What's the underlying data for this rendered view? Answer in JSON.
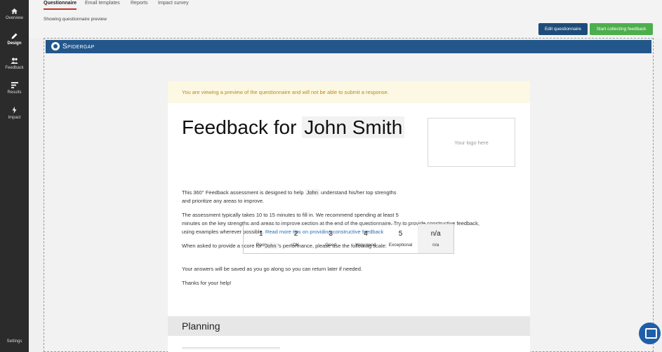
{
  "sidebar": {
    "items": [
      {
        "label": "Overview",
        "icon": "home-icon"
      },
      {
        "label": "Design",
        "icon": "pencil-icon"
      },
      {
        "label": "Feedback",
        "icon": "users-icon"
      },
      {
        "label": "Results",
        "icon": "bars-icon"
      },
      {
        "label": "Impact",
        "icon": "bolt-icon"
      }
    ],
    "settings_label": "Settings"
  },
  "tabs": [
    "Questionnaire",
    "Email templates",
    "Reports",
    "Impact survey"
  ],
  "subheader": {
    "showing": "Showing questionnaire preview",
    "edit_label": "Edit questionnaire",
    "start_label": "Start collecting feedback"
  },
  "preview": {
    "brand": "Spidergap",
    "notice": "You are viewing a preview of the questionnaire and will not be able to submit a response.",
    "title_prefix": "Feedback for",
    "name": "John Smith",
    "logo_placeholder": "Your logo here",
    "intro_1": "This 360° Feedback assessment is designed to help",
    "first_name": "John",
    "intro_2": "understand his/her top strengths",
    "intro_3": "and prioritize any areas to improve.",
    "time_line_1": "The assessment typically takes 10 to 15 minutes to fill in. We recommend spending at least 5",
    "time_line_2": "minutes on the key strengths and areas to improve section at the end of the questionnaire. Try to provide constructive feedback,",
    "time_line_3": "using examples wherever possible.",
    "tips_link": "Read more tips on providing constructive feedback",
    "scale_intro_1": "When asked to provide a score for",
    "scale_intro_2": "'s performance, please use the following scale:",
    "scale": [
      {
        "value": "1",
        "label": "Poor"
      },
      {
        "value": "2",
        "label": "OK"
      },
      {
        "value": "3",
        "label": "Good"
      },
      {
        "value": "4",
        "label": "Very good"
      },
      {
        "value": "5",
        "label": "Exceptional"
      },
      {
        "value": "n/a",
        "label": "n/a"
      }
    ],
    "saved_note": "Your answers will be saved as you go along so you can return later if needed.",
    "thanks": "Thanks for your help!",
    "section_title": "Planning"
  },
  "colors": {
    "sidebar_bg": "#2b2b2b",
    "brand_blue": "#23578c",
    "edit_button": "#1d4c7a",
    "start_button": "#4cae4c",
    "active_tab_underline": "#c9302c",
    "notice_text": "#b8891f",
    "link": "#2a6ebb"
  }
}
